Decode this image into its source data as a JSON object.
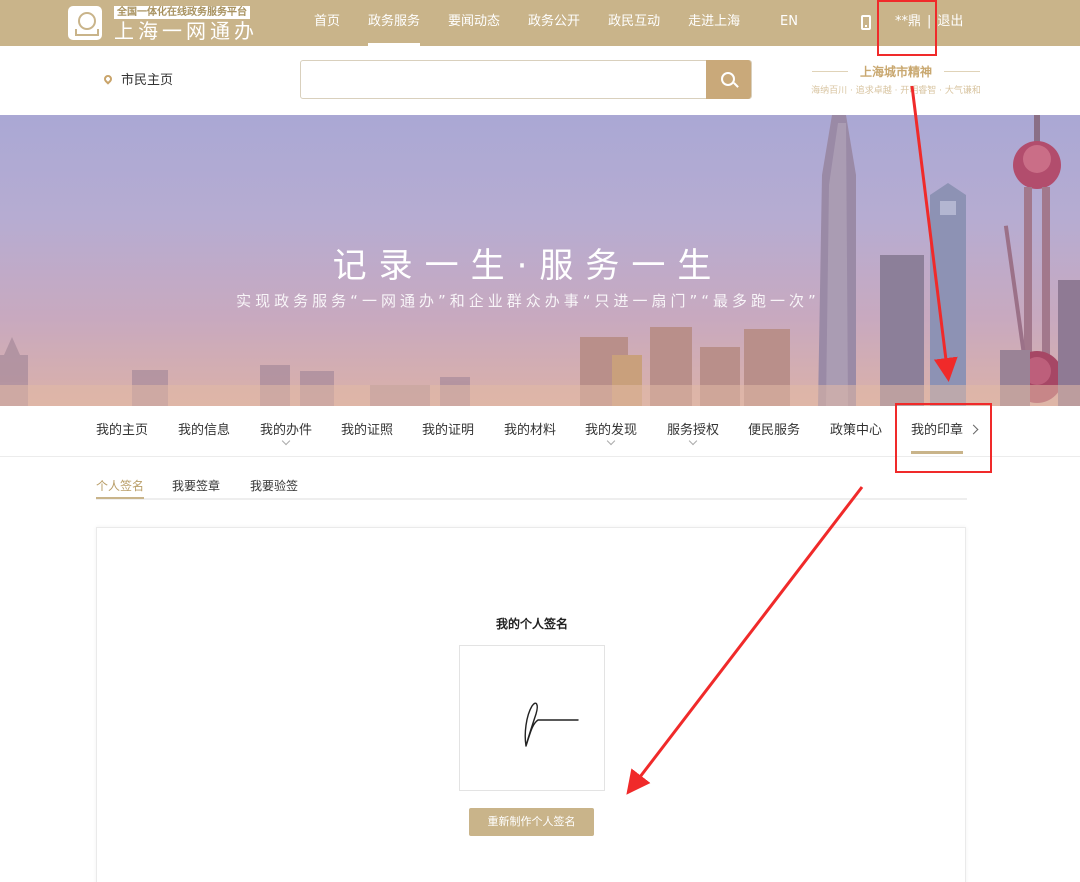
{
  "header": {
    "logo_tagline": "全国一体化在线政务服务平台",
    "logo_name": "上海一网通办",
    "nav": [
      {
        "label": "首页",
        "active": false
      },
      {
        "label": "政务服务",
        "active": true
      },
      {
        "label": "要闻动态",
        "active": false
      },
      {
        "label": "政务公开",
        "active": false
      },
      {
        "label": "政民互动",
        "active": false
      },
      {
        "label": "走进上海",
        "active": false
      }
    ],
    "lang": "EN",
    "user_name": "**鼎",
    "logout_label": "退出",
    "separator": "|"
  },
  "searchbar": {
    "location_label": "市民主页",
    "placeholder": "",
    "spirit_title": "上海城市精神",
    "spirit_sub": "海纳百川 · 追求卓越 · 开明睿智 · 大气谦和"
  },
  "banner": {
    "title": "记录一生·服务一生",
    "subtitle": "实现政务服务“一网通办”和企业群众办事“只进一扇门”“最多跑一次”"
  },
  "subnav": {
    "items": [
      {
        "label": "我的主页",
        "has_dropdown": false
      },
      {
        "label": "我的信息",
        "has_dropdown": false
      },
      {
        "label": "我的办件",
        "has_dropdown": true
      },
      {
        "label": "我的证照",
        "has_dropdown": false
      },
      {
        "label": "我的证明",
        "has_dropdown": false
      },
      {
        "label": "我的材料",
        "has_dropdown": false
      },
      {
        "label": "我的发现",
        "has_dropdown": true
      },
      {
        "label": "服务授权",
        "has_dropdown": true
      },
      {
        "label": "便民服务",
        "has_dropdown": false
      },
      {
        "label": "政策中心",
        "has_dropdown": false
      },
      {
        "label": "我的印章",
        "has_dropdown": false,
        "active": true
      }
    ]
  },
  "tabs": [
    {
      "label": "个人签名",
      "active": true
    },
    {
      "label": "我要签章",
      "active": false
    },
    {
      "label": "我要验签",
      "active": false
    }
  ],
  "signature": {
    "title": "我的个人签名",
    "remake_label": "重新制作个人签名"
  },
  "colors": {
    "brand_gold": "#c9b48a",
    "annotation_red": "#f02a2a"
  }
}
